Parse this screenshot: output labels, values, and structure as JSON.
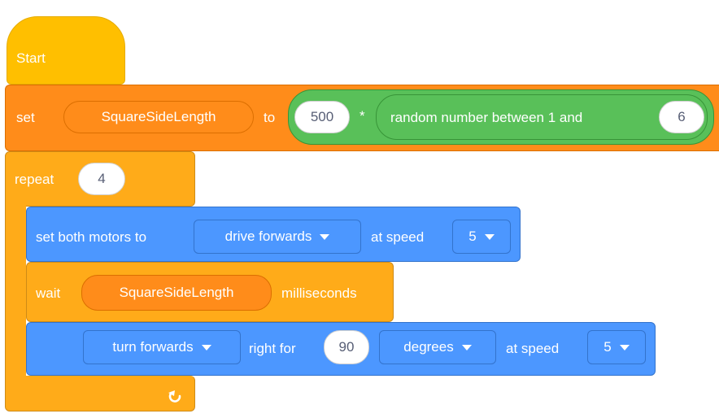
{
  "hat": {
    "label": "Start"
  },
  "set_block": {
    "set_label": "set",
    "variable": "SquareSideLength",
    "to_label": "to",
    "multiplier": "500",
    "operator": "*",
    "random_label": "random number between 1 and",
    "random_max": "6"
  },
  "repeat_block": {
    "label": "repeat",
    "count": "4",
    "loop_icon": "loop-arrow-icon"
  },
  "drive_block": {
    "label": "set both motors to",
    "direction": "drive forwards",
    "speed_label": "at speed",
    "speed": "5"
  },
  "wait_block": {
    "label": "wait",
    "variable": "SquareSideLength",
    "unit": "milliseconds"
  },
  "turn_block": {
    "direction": "turn forwards",
    "right_label": "right for",
    "amount": "90",
    "unit": "degrees",
    "speed_label": "at speed",
    "speed": "5"
  },
  "colors": {
    "events": "#FFBF00",
    "variables": "#FF8C1A",
    "control": "#FFAB19",
    "operators": "#59C059",
    "motion": "#4C97FF"
  }
}
